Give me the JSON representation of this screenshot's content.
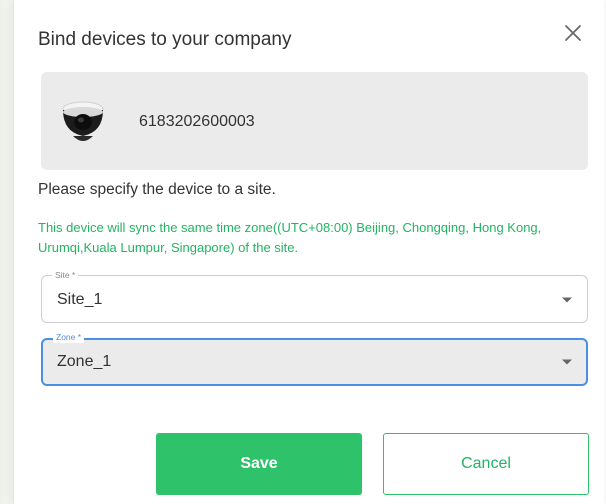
{
  "dialog": {
    "title": "Bind devices to your company",
    "close_icon": "close-icon"
  },
  "device": {
    "icon": "dome-camera-icon",
    "serial": "6183202600003"
  },
  "instruction": "Please specify the device to a site.",
  "timezone_note": "This device will sync the same time zone((UTC+08:00) Beijing, Chongqing, Hong Kong, Urumqi,Kuala Lumpur, Singapore) of the site.",
  "site_field": {
    "label": "Site *",
    "value": "Site_1",
    "icon": "chevron-down-icon"
  },
  "zone_field": {
    "label": "Zone *",
    "value": "Zone_1",
    "icon": "chevron-down-icon",
    "focused": true
  },
  "buttons": {
    "save_label": "Save",
    "cancel_label": "Cancel"
  },
  "colors": {
    "accent_green": "#2ec36a",
    "note_green": "#22b463",
    "focus_blue": "#4c8fe0",
    "card_gray": "#ebebeb"
  }
}
